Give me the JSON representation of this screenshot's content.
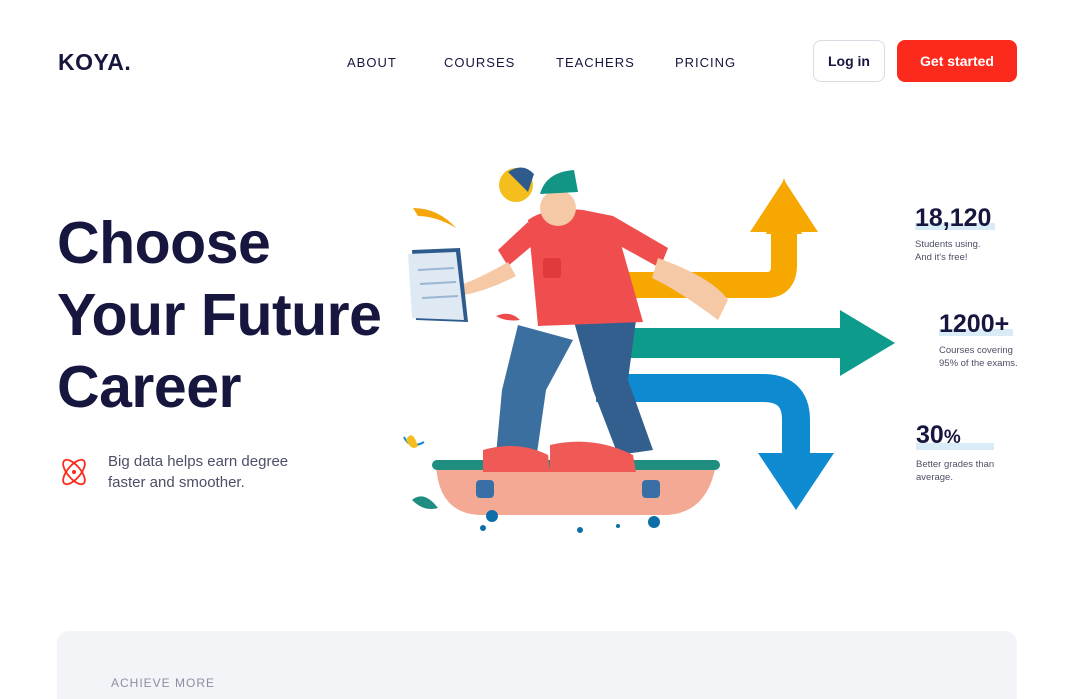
{
  "brand": {
    "logo": "KOYA."
  },
  "nav": {
    "items": [
      "ABOUT",
      "COURSES",
      "TEACHERS",
      "PRICING"
    ]
  },
  "header": {
    "login_label": "Log in",
    "cta_label": "Get started"
  },
  "hero": {
    "title_lines": [
      "Choose",
      "Your Future",
      "Career"
    ],
    "feature_text_lines": [
      "Big data helps earn degree",
      "faster and smoother."
    ]
  },
  "stats": [
    {
      "value": "18,120",
      "desc_lines": [
        "Students using.",
        "And it's free!"
      ]
    },
    {
      "value": "1200+",
      "desc_lines": [
        "Courses covering",
        "95% of the exams."
      ]
    },
    {
      "value": "30",
      "suffix": "%",
      "desc_lines": [
        "Better grades than",
        "average."
      ]
    }
  ],
  "section": {
    "label": "ACHIEVE MORE"
  },
  "colors": {
    "accent": "#fc2a1c",
    "text_dark": "#16163f",
    "arrow_orange": "#f7a800",
    "arrow_teal": "#0d9c8c",
    "arrow_blue": "#0d8ad0"
  },
  "icons": {
    "feature": "atom-icon"
  }
}
